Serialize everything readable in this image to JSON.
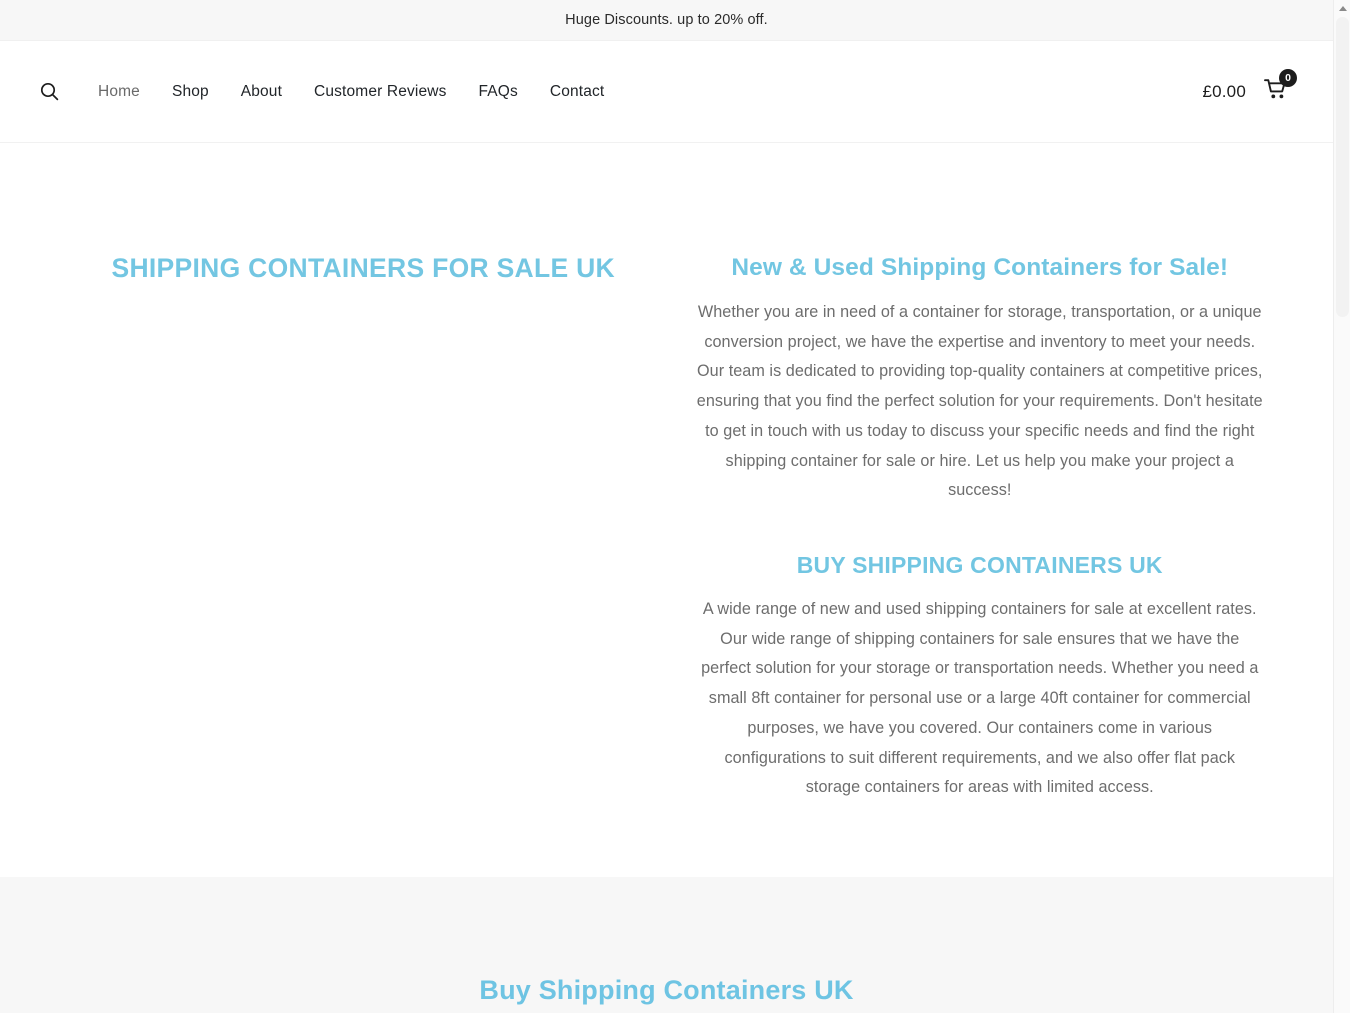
{
  "announcement": {
    "text": "Huge Discounts. up to 20% off."
  },
  "header": {
    "search_icon": "search-icon",
    "nav": [
      {
        "label": "Home"
      },
      {
        "label": "Shop"
      },
      {
        "label": "About"
      },
      {
        "label": "Customer Reviews"
      },
      {
        "label": "FAQs"
      },
      {
        "label": "Contact"
      }
    ],
    "cart": {
      "total": "£0.00",
      "count": "0",
      "icon": "shopping-cart-icon"
    }
  },
  "hero": {
    "left_title": "SHIPPING CONTAINERS FOR SALE UK",
    "right_title": "New & Used Shipping Containers for Sale!",
    "right_paragraph": "Whether you are in need of a container for storage, transportation, or a unique conversion project, we have the expertise and inventory to meet your needs. Our team is dedicated to providing top-quality containers at competitive prices, ensuring that you find the perfect solution for your requirements. Don't hesitate to get in touch with us today to discuss your specific needs and find the right shipping container for sale or hire. Let us help you make your project a success!",
    "sub_title": "BUY SHIPPING CONTAINERS UK",
    "sub_paragraph": "A wide range of new and used shipping containers for sale at excellent rates. Our wide range of shipping containers for sale ensures that we have the perfect solution for your storage or transportation needs. Whether you need a small 8ft container for personal use or a large 40ft container for commercial purposes, we have you covered. Our containers come in various configurations to suit different requirements, and we also offer flat pack storage containers for areas with limited access."
  },
  "lower_section": {
    "title": "Buy Shipping Containers UK"
  },
  "colors": {
    "heading_blue": "#72c6e2",
    "body_text": "#6d6d6d",
    "nav_text": "#212529",
    "band_background": "#f7f7f7",
    "announce_background": "#f7f7f7"
  }
}
